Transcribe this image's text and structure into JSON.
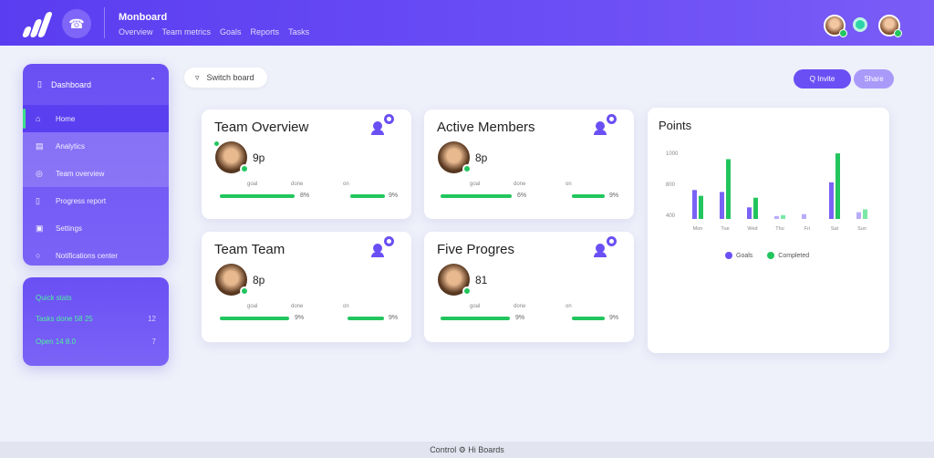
{
  "header": {
    "title": "Monboard",
    "nav": [
      "Overview",
      "Team metrics",
      "Goals",
      "Reports",
      "Tasks"
    ],
    "circle_icon": "phone-icon"
  },
  "sidebar": {
    "title": "Dashboard",
    "items": [
      {
        "label": "Home",
        "icon": "home-icon"
      },
      {
        "label": "Analytics",
        "icon": "chart-icon"
      },
      {
        "label": "Team overview",
        "icon": "users-icon"
      },
      {
        "label": "Progress report",
        "icon": "report-icon"
      },
      {
        "label": "Settings",
        "icon": "settings-icon"
      },
      {
        "label": "Notifications center",
        "icon": "bell-icon"
      }
    ]
  },
  "sidebar_summary": {
    "title": "Quick stats",
    "rows": [
      {
        "label": "Tasks done  58 25",
        "value": "12"
      },
      {
        "label": "Open  14  8.0",
        "value": "7"
      }
    ]
  },
  "toolbar": {
    "search_label": "Switch board",
    "primary_label": "Q  Invite",
    "secondary_label": "Share"
  },
  "cards": [
    {
      "title": "Team Overview",
      "count": "9p",
      "labels": [
        "goal",
        "done",
        "on"
      ],
      "bar_labels": [
        "8%",
        "9%"
      ]
    },
    {
      "title": "Active Members",
      "count": "8p",
      "labels": [
        "goal",
        "done",
        "on"
      ],
      "bar_labels": [
        "6%",
        "9%"
      ]
    },
    {
      "title": "Team Team",
      "count": "8p",
      "labels": [
        "goal",
        "done",
        "on"
      ],
      "bar_labels": [
        "9%",
        "9%"
      ]
    },
    {
      "title": "Five Progres",
      "count": "81",
      "labels": [
        "goal",
        "done",
        "on"
      ],
      "bar_labels": [
        "9%",
        "9%"
      ]
    }
  ],
  "colors": {
    "accent": "#6a4ff4",
    "green": "#22c55e",
    "light_purple": "#a99af9"
  },
  "chart_data": {
    "type": "bar",
    "title": "Points",
    "categories": [
      "Mon",
      "Tue",
      "Wed",
      "Thu",
      "Fri",
      "Sat",
      "Sun"
    ],
    "series": [
      {
        "name": "Goals",
        "values": [
          30,
          28,
          12,
          3,
          5,
          38,
          7
        ]
      },
      {
        "name": "Completed",
        "values": [
          24,
          62,
          22,
          4,
          0,
          68,
          10
        ]
      }
    ],
    "ylabels": [
      "1000",
      "800",
      "400"
    ],
    "legend": "bottom"
  },
  "footer": {
    "text": "Control ⚙ Hi Boards"
  }
}
